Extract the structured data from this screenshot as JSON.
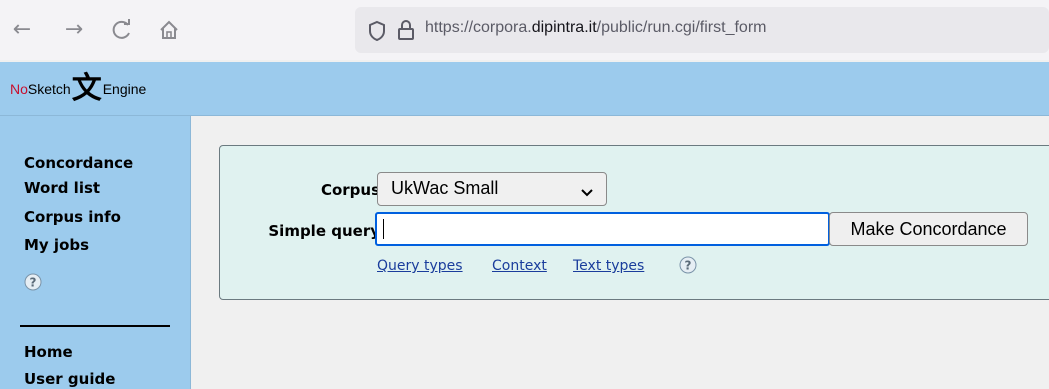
{
  "browser": {
    "url_prefix": "https://corpora.",
    "url_domain": "dipintra.it",
    "url_path": "/public/run.cgi/first_form",
    "icons": {
      "back": "back-arrow-icon",
      "forward": "forward-arrow-icon",
      "reload": "reload-icon",
      "home": "home-icon",
      "shield": "shield-icon",
      "lock": "lock-icon"
    }
  },
  "logo": {
    "prefix": "No",
    "word1": "Sketch",
    "glyph": "文",
    "word2": "Engine"
  },
  "sidebar": {
    "items": [
      {
        "label": "Concordance"
      },
      {
        "label": "Word list"
      },
      {
        "label": "Corpus info"
      },
      {
        "label": "My jobs"
      }
    ],
    "bottom_items": [
      {
        "label": "Home"
      },
      {
        "label": "User guide"
      }
    ],
    "help_icon": "help-icon"
  },
  "form": {
    "corpus_label": "Corpus:",
    "corpus_value": "UkWac Small",
    "query_label": "Simple query:",
    "query_value": "",
    "submit_label": "Make Concordance",
    "links": [
      "Query types",
      "Context",
      "Text types"
    ]
  },
  "colors": {
    "header_bg": "#9ccbed",
    "panel_bg": "#e0f2f0",
    "focus_border": "#0060df",
    "link": "#1a3d9c",
    "logo_red": "#c8102e"
  }
}
